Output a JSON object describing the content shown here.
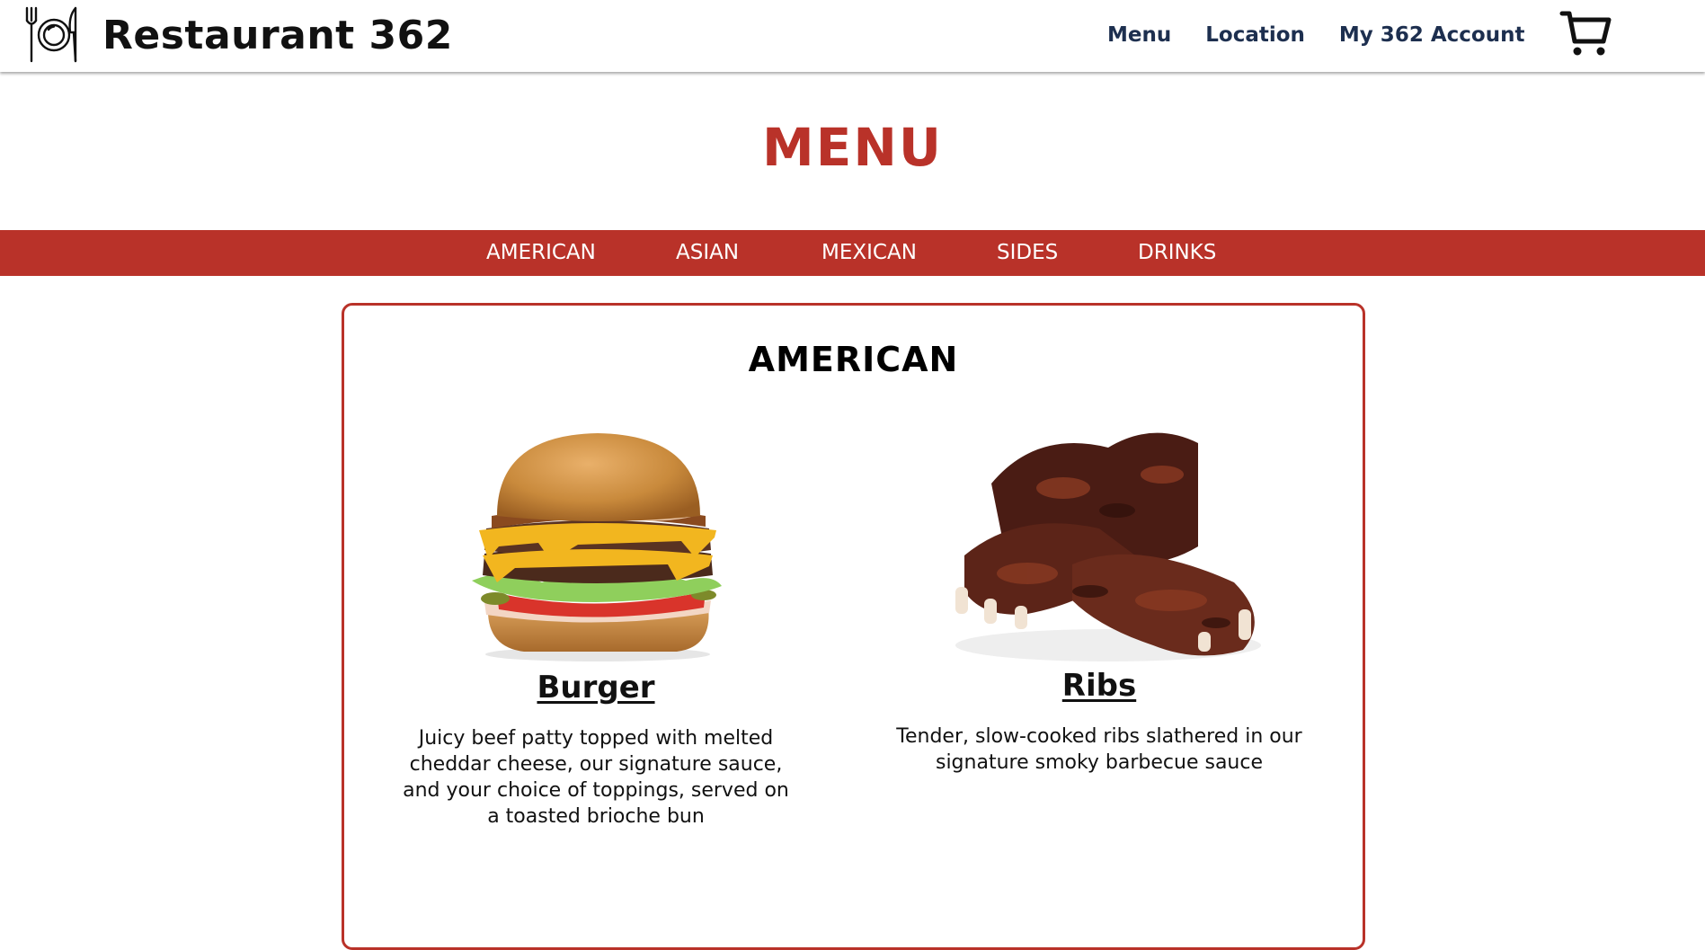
{
  "header": {
    "brand": "Restaurant 362",
    "nav": [
      "Menu",
      "Location",
      "My 362 Account"
    ]
  },
  "icons": {
    "logo": "plate-fork-knife-icon",
    "cart": "shopping-cart-icon"
  },
  "page": {
    "title": "MENU"
  },
  "categories": [
    "AMERICAN",
    "ASIAN",
    "MEXICAN",
    "SIDES",
    "DRINKS"
  ],
  "section": {
    "title": "AMERICAN",
    "items": [
      {
        "name": "Burger",
        "description": "Juicy beef patty topped with melted cheddar cheese, our signature sauce, and your choice of toppings, served on a toasted brioche bun"
      },
      {
        "name": "Ribs",
        "description": "Tender, slow-cooked ribs slathered in our signature smoky barbecue sauce"
      }
    ]
  },
  "colors": {
    "accent": "#b93229",
    "nav_text": "#1d2f4f"
  }
}
